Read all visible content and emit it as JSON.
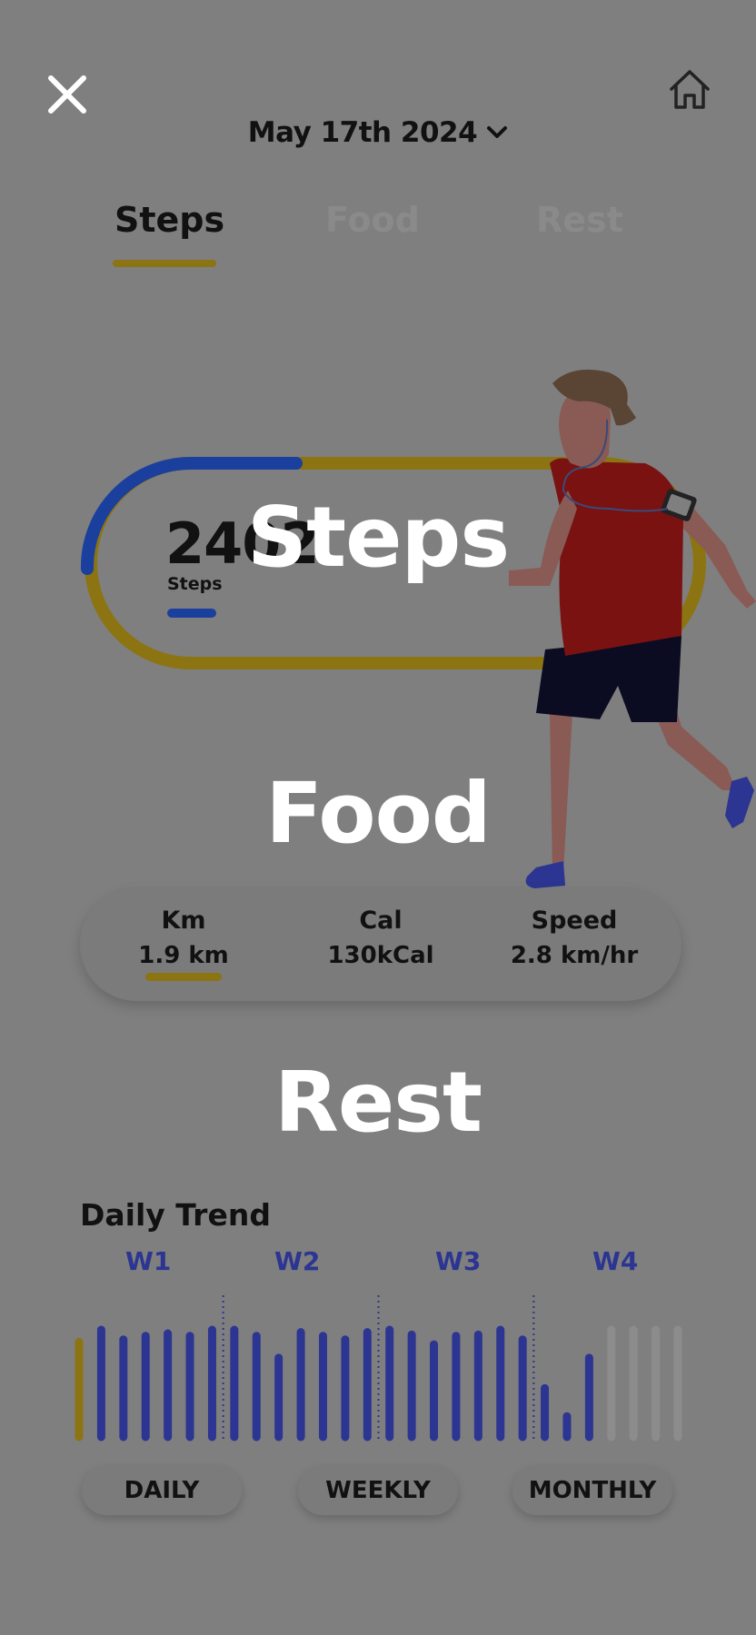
{
  "header": {
    "date": "May 17th 2024",
    "close_icon": "close-icon",
    "home_icon": "home-icon"
  },
  "tabs": [
    {
      "label": "Steps",
      "active": true
    },
    {
      "label": "Food",
      "active": false
    },
    {
      "label": "Rest",
      "active": false
    }
  ],
  "steps_card": {
    "count": "2402",
    "label": "Steps",
    "progress_fraction": 0.22
  },
  "overlay_titles": {
    "steps": "Steps",
    "food": "Food",
    "rest": "Rest"
  },
  "stats": [
    {
      "label": "Km",
      "value": "1.9 km",
      "highlighted": true
    },
    {
      "label": "Cal",
      "value": "130kCal",
      "highlighted": false
    },
    {
      "label": "Speed",
      "value": "2.8 km/hr",
      "highlighted": false
    }
  ],
  "trend": {
    "title": "Daily Trend",
    "weeks": [
      "W1",
      "W2",
      "W3",
      "W4"
    ]
  },
  "chart_data": {
    "type": "bar",
    "title": "Daily Trend",
    "weeks": [
      "W1",
      "W2",
      "W3",
      "W4"
    ],
    "values": [
      0.78,
      0.88,
      0.8,
      0.83,
      0.85,
      0.83,
      0.88,
      0.88,
      0.83,
      0.65,
      0.86,
      0.83,
      0.8,
      0.86,
      0.88,
      0.84,
      0.76,
      0.83,
      0.84,
      0.88,
      0.8,
      0.4,
      0.17,
      0.65,
      0.88,
      0.88,
      0.88,
      0.88
    ],
    "status": [
      "highlight",
      "done",
      "done",
      "done",
      "done",
      "done",
      "done",
      "done",
      "done",
      "done",
      "done",
      "done",
      "done",
      "done",
      "done",
      "done",
      "done",
      "done",
      "done",
      "done",
      "done",
      "done",
      "done",
      "done",
      "future",
      "future",
      "future",
      "future"
    ],
    "ylim": [
      0,
      1
    ]
  },
  "ranges": [
    "DAILY",
    "WEEKLY",
    "MONTHLY"
  ],
  "colors": {
    "background": "#7f7f7f",
    "accent_gold": "#8c7412",
    "accent_blue": "#1a3f9d",
    "bar_blue": "#2c3591",
    "bar_future": "#8c8c8c"
  }
}
